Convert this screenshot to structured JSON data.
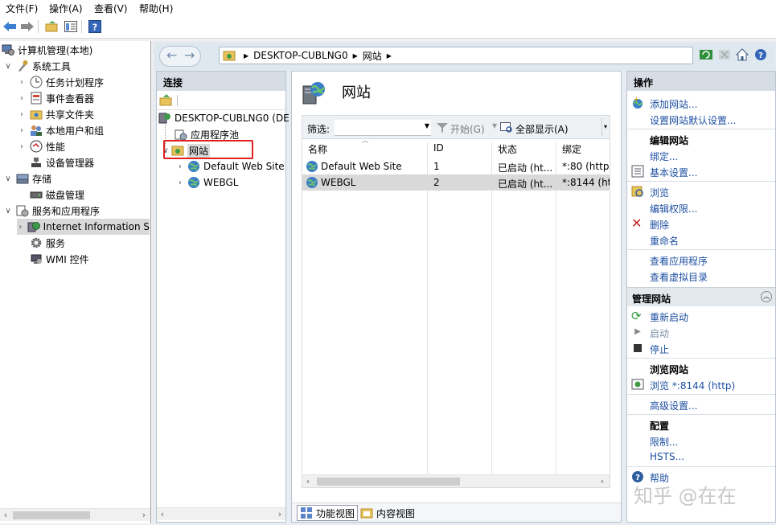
{
  "menu": {
    "file": "文件(F)",
    "action": "操作(A)",
    "view": "查看(V)",
    "help": "帮助(H)"
  },
  "left_tree": {
    "root": "计算机管理(本地)",
    "system_tools": "系统工具",
    "task_scheduler": "任务计划程序",
    "event_viewer": "事件查看器",
    "shared_folders": "共享文件夹",
    "local_users": "本地用户和组",
    "performance": "性能",
    "device_manager": "设备管理器",
    "storage": "存储",
    "disk_management": "磁盘管理",
    "services_apps": "服务和应用程序",
    "iis": "Internet Information S",
    "services": "服务",
    "wmi": "WMI 控件"
  },
  "address": {
    "host": "DESKTOP-CUBLNG0",
    "sites": "网站"
  },
  "connections": {
    "header": "连接",
    "server": "DESKTOP-CUBLNG0 (DE",
    "app_pools": "应用程序池",
    "sites": "网站",
    "site1": "Default Web Site",
    "site2": "WEBGL"
  },
  "center": {
    "title": "网站",
    "filter_label": "筛选:",
    "start_btn": "开始(G)",
    "show_all_btn": "全部显示(A)",
    "columns": [
      "名称",
      "ID",
      "状态",
      "绑定"
    ],
    "rows": [
      {
        "name": "Default Web Site",
        "id": "1",
        "status": "已启动 (ht...",
        "binding": "*:80 (http)"
      },
      {
        "name": "WEBGL",
        "id": "2",
        "status": "已启动 (ht...",
        "binding": "*:8144 (htt"
      }
    ],
    "tab_features": "功能视图",
    "tab_content": "内容视图"
  },
  "actions": {
    "header": "操作",
    "add_site": "添加网站...",
    "set_defaults": "设置网站默认设置...",
    "edit_site": "编辑网站",
    "bindings": "绑定...",
    "basic_settings": "基本设置...",
    "browse": "浏览",
    "edit_perms": "编辑权限...",
    "delete": "删除",
    "rename": "重命名",
    "view_apps": "查看应用程序",
    "view_vdirs": "查看虚拟目录",
    "manage_site": "管理网站",
    "restart": "重新启动",
    "start": "启动",
    "stop": "停止",
    "browse_site": "浏览网站",
    "browse_link": "浏览 *:8144 (http)",
    "advanced": "高级设置...",
    "config": "配置",
    "limits": "限制...",
    "hsts": "HSTS...",
    "help": "帮助"
  },
  "watermark": "知乎 @在在",
  "colors": {
    "selected_row": "#d9d9d9",
    "link": "#1e50a2",
    "highlight_box": "#e02020"
  }
}
